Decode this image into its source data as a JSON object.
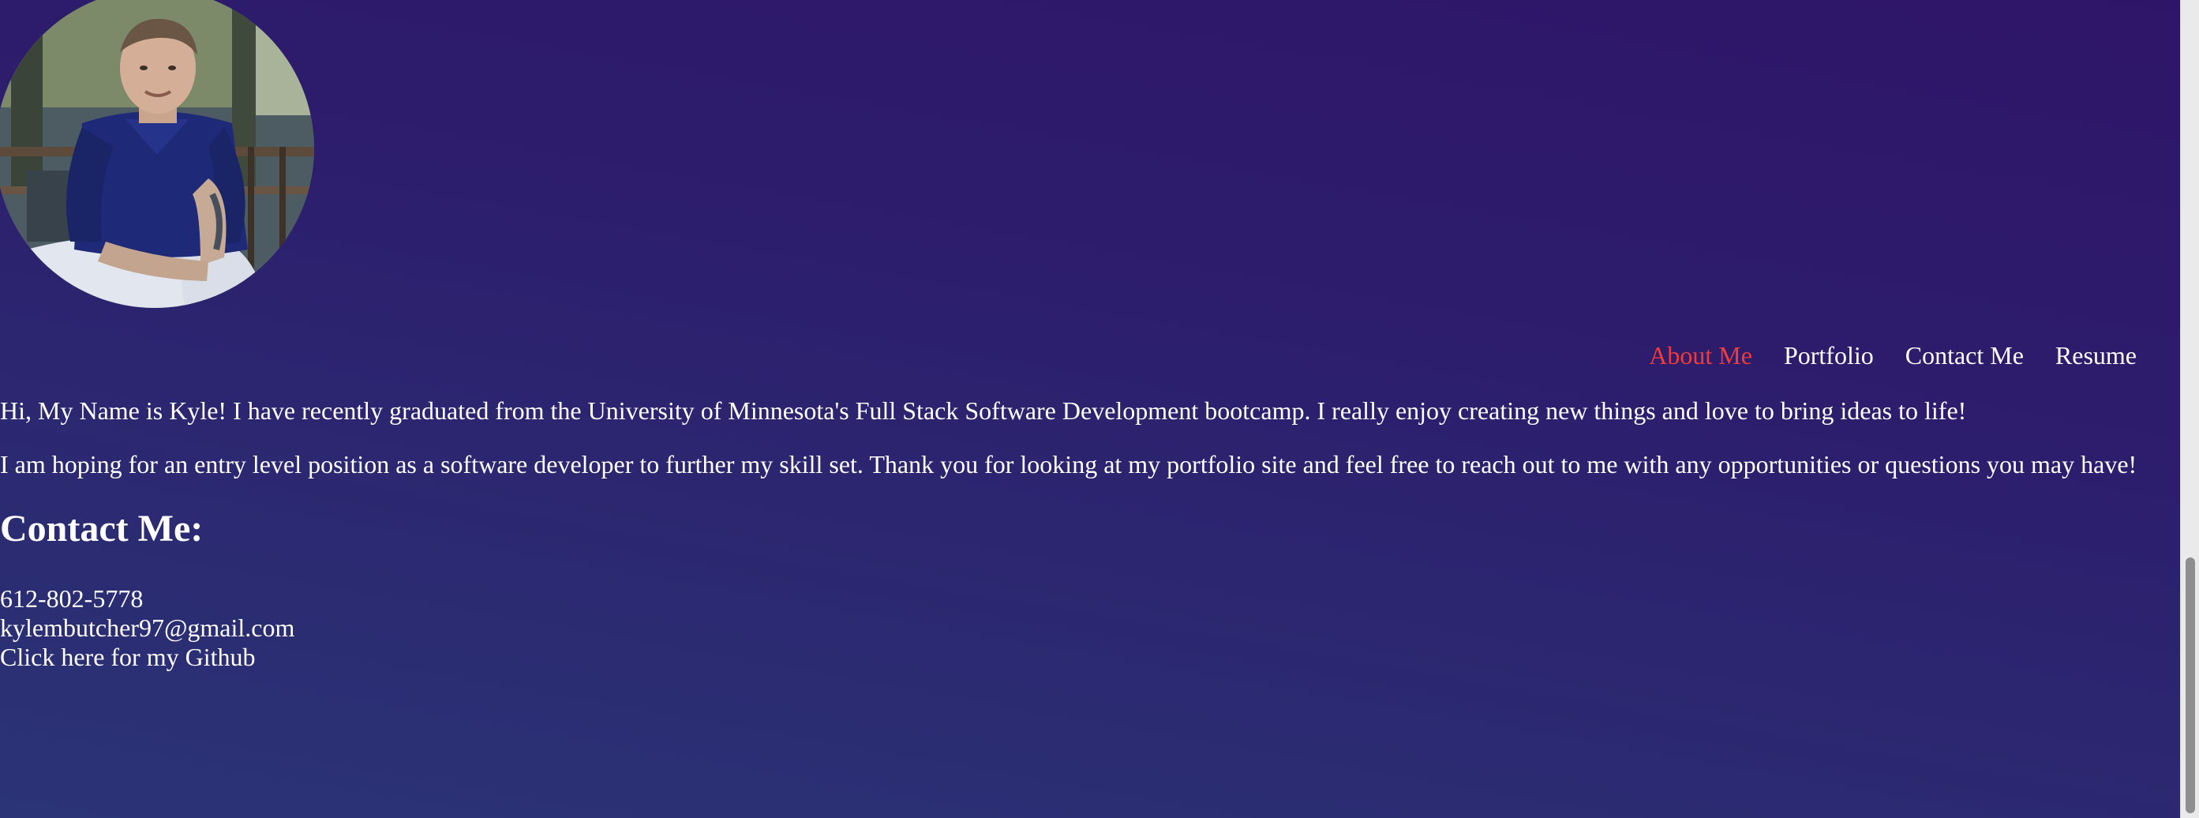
{
  "profile": {
    "photo_icon": "profile-photo"
  },
  "nav": {
    "items": [
      {
        "label": "About Me",
        "active": true
      },
      {
        "label": "Portfolio",
        "active": false
      },
      {
        "label": "Contact Me",
        "active": false
      },
      {
        "label": "Resume",
        "active": false
      }
    ],
    "active_color": "#ee3b3b"
  },
  "about": {
    "paragraph_1": "Hi, My Name is Kyle! I have recently graduated from the University of Minnesota's Full Stack Software Development bootcamp. I really enjoy creating new things and love to bring ideas to life!",
    "paragraph_2": "I am hoping for an entry level position as a software developer to further my skill set. Thank you for looking at my portfolio site and feel free to reach out to me with any opportunities or questions you may have!"
  },
  "contact": {
    "heading": "Contact Me:",
    "phone": "612-802-5778",
    "email": "kylembutcher97@gmail.com",
    "github_link": "Click here for my Github"
  },
  "theme": {
    "background_top": "#2f1568",
    "background_bottom": "#2b3476",
    "text": "#ffffff"
  }
}
